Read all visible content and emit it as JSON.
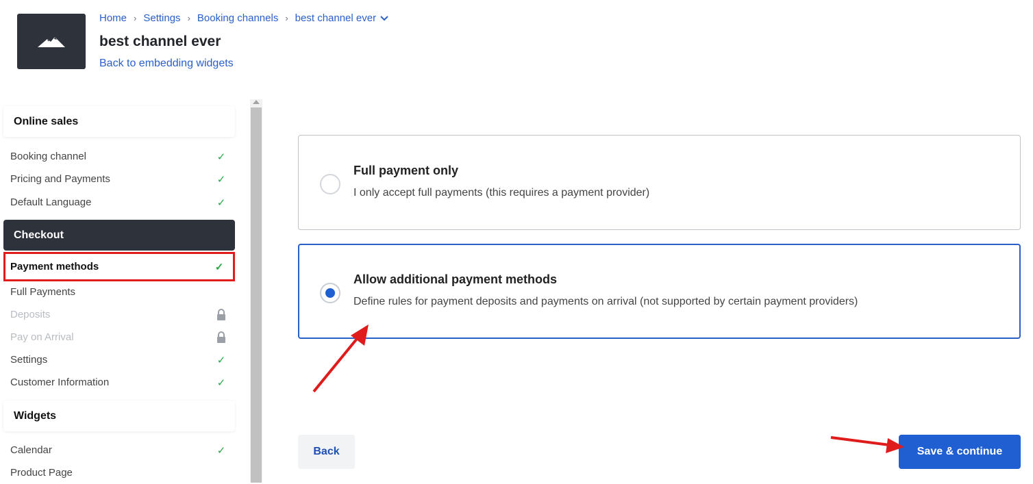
{
  "breadcrumb": {
    "items": [
      "Home",
      "Settings",
      "Booking channels",
      "best channel ever"
    ]
  },
  "header": {
    "title": "best channel ever",
    "back_link": "Back to embedding widgets",
    "logo_icon": "mountain-icon"
  },
  "sidebar": {
    "sections": {
      "online_sales": "Online sales",
      "checkout": "Checkout",
      "widgets": "Widgets"
    },
    "online_sales_items": [
      {
        "label": "Booking channel",
        "status": "check"
      },
      {
        "label": "Pricing and Payments",
        "status": "check"
      },
      {
        "label": "Default Language",
        "status": "check"
      }
    ],
    "checkout_items": [
      {
        "label": "Payment methods",
        "status": "check"
      },
      {
        "label": "Full Payments",
        "status": "none"
      },
      {
        "label": "Deposits",
        "status": "lock"
      },
      {
        "label": "Pay on Arrival",
        "status": "lock"
      },
      {
        "label": "Settings",
        "status": "check"
      },
      {
        "label": "Customer Information",
        "status": "check"
      }
    ],
    "widgets_items": [
      {
        "label": "Calendar",
        "status": "check"
      },
      {
        "label": "Product Page",
        "status": "none"
      }
    ]
  },
  "main": {
    "options": [
      {
        "title": "Full payment only",
        "description": "I only accept full payments (this requires a payment provider)",
        "selected": false
      },
      {
        "title": "Allow additional payment methods",
        "description": "Define rules for payment deposits and payments on arrival (not supported by certain payment providers)",
        "selected": true
      }
    ],
    "back_label": "Back",
    "save_label": "Save & continue"
  },
  "colors": {
    "accent": "#1f5fd1",
    "link": "#2a5fc8",
    "dark": "#2e333b",
    "success": "#28a745",
    "annotation": "#e01b1b"
  }
}
